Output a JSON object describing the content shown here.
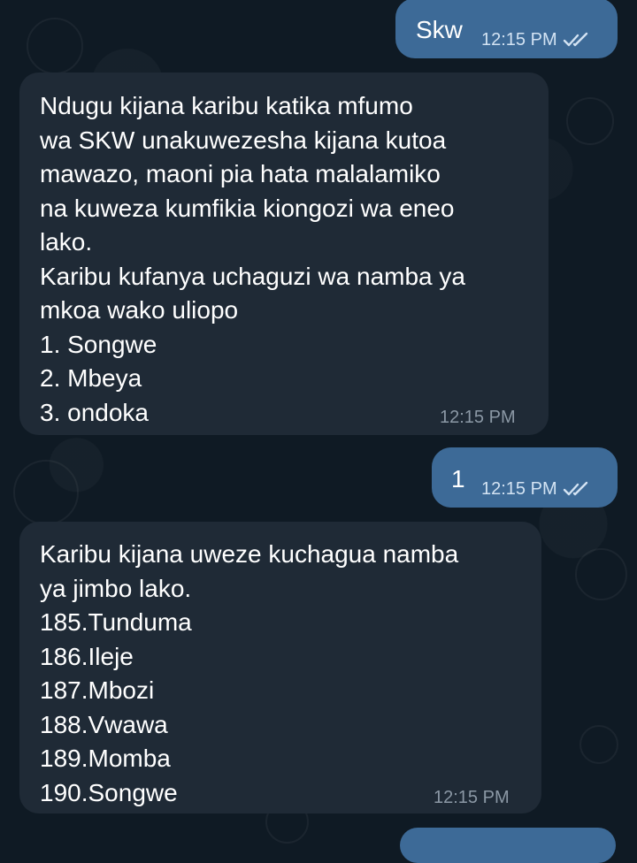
{
  "messages": [
    {
      "direction": "out",
      "text": "Skw",
      "time": "12:15 PM",
      "status_icon": "double-check-icon"
    },
    {
      "direction": "in",
      "text": "Ndugu kijana karibu katika mfumo\nwa SKW unakuwezesha kijana kutoa\nmawazo, maoni pia hata malalamiko\nna kuweza kumfikia kiongozi wa eneo\nlako.\nKaribu kufanya uchaguzi wa namba ya\nmkoa wako uliopo\n1. Songwe\n2. Mbeya\n3. ondoka",
      "time": "12:15 PM"
    },
    {
      "direction": "out",
      "text": "1",
      "time": "12:15 PM",
      "status_icon": "double-check-icon"
    },
    {
      "direction": "in",
      "text": "Karibu kijana uweze kuchagua namba\nya jimbo lako.\n185.Tunduma\n186.Ileje\n187.Mbozi\n188.Vwawa\n189.Momba\n190.Songwe",
      "time": "12:15 PM"
    }
  ],
  "colors": {
    "background": "#0f1a24",
    "incoming_bubble": "#1f2a36",
    "outgoing_bubble": "#3d6a97",
    "incoming_time": "#8b98a5",
    "outgoing_time": "#d3e3f3"
  }
}
